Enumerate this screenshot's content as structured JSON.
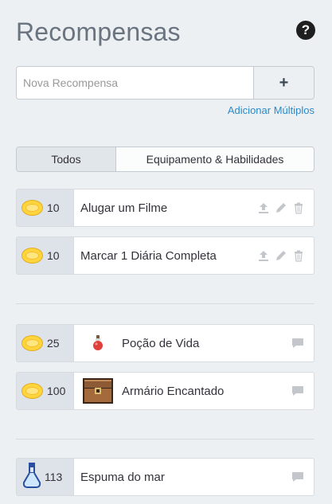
{
  "header": {
    "title": "Recompensas"
  },
  "add_reward": {
    "placeholder": "Nova Recompensa",
    "button_label": "+",
    "multiple_link": "Adicionar Múltiplos"
  },
  "filters": {
    "tabs": [
      {
        "label": "Todos"
      },
      {
        "label": "Equipamento & Habilidades"
      }
    ]
  },
  "custom_rewards": [
    {
      "price": "10",
      "text": "Alugar um Filme"
    },
    {
      "price": "10",
      "text": "Marcar 1 Diária Completa"
    }
  ],
  "shop_items": [
    {
      "price": "25",
      "text": "Poção de Vida",
      "icon": "health-potion-icon"
    },
    {
      "price": "100",
      "text": "Armário Encantado",
      "icon": "enchanted-armoire-icon"
    }
  ],
  "gem_items": [
    {
      "price": "113",
      "text": "Espuma do mar",
      "icon": "potion-bottle-icon"
    }
  ],
  "colors": {
    "accent_link": "#2a8ac9",
    "coin": "#ffd53b",
    "price_bg": "#dde3e8"
  }
}
